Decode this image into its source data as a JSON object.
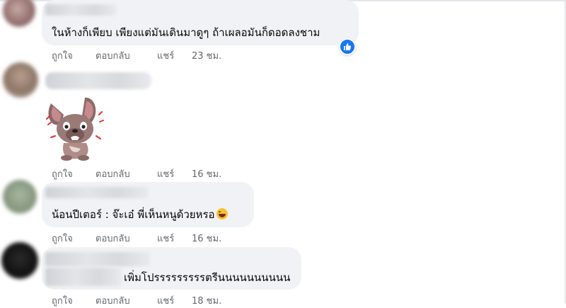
{
  "comments": [
    {
      "text": "ในห้างก็เพียบ เพียงแต่มันเดินมาดูๆ ถ้าเผลอมันก็ดอดลงชาม",
      "actions": {
        "like": "ถูกใจ",
        "reply": "ตอบกลับ",
        "share": "แชร์",
        "time": "23 ชม."
      },
      "reaction_icon": "thumbs-up-icon"
    },
    {
      "text": "",
      "sticker": "crying-dog-sticker",
      "actions": {
        "like": "ถูกใจ",
        "reply": "ตอบกลับ",
        "share": "แชร์",
        "time": "16 ชม."
      }
    },
    {
      "text": "น้อนปีเตอร์ : จ๊ะเอ๋ พี่เห็นหนูด้วยหรอ",
      "emoji": "laughing-emoji",
      "actions": {
        "like": "ถูกใจ",
        "reply": "ตอบกลับ",
        "share": "แชร์",
        "time": "16 ชม."
      }
    },
    {
      "text": "เพิ่มโปรรรรรรรรรตรีนนนนนนนนนน",
      "actions": {
        "like": "ถูกใจ",
        "reply": "ตอบกลับ",
        "share": "แชร์",
        "time": "18 ชม."
      }
    }
  ],
  "colors": {
    "bubble": "#f0f2f5",
    "action_text": "#65676b",
    "like_blue": "#1877f2"
  }
}
